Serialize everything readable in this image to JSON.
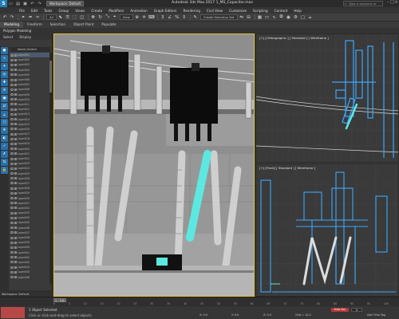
{
  "app": {
    "logo": "S",
    "workspace": "Workspace: Default",
    "title": "Autodesk 3ds Max 2017    1_MS_Capacitor.max",
    "search_placeholder": "Type a keyword or phrase"
  },
  "menu": [
    "File",
    "Edit",
    "Tools",
    "Group",
    "Views",
    "Create",
    "Modifiers",
    "Animation",
    "Graph Editors",
    "Rendering",
    "Civil View",
    "Customize",
    "Scripting",
    "Content",
    "Help"
  ],
  "toolbar": {
    "filter_dropdown": "All",
    "view_dropdown": "View",
    "selection_set": "Create Selection Set"
  },
  "ribbon": {
    "tabs": [
      "Modeling",
      "Freeform",
      "Selection",
      "Object Paint",
      "Populate"
    ],
    "active_tab": "Modeling",
    "sub_label": "Polygon Modeling"
  },
  "explorer": {
    "tabs": [
      "Select",
      "Display"
    ],
    "header": "Name (Sorted Ascending)",
    "rows": [
      "Layer001",
      "Layer002",
      "Layer003",
      "Layer004",
      "Layer005",
      "Layer006",
      "Layer007",
      "Layer008",
      "Layer009",
      "Layer010",
      "Layer011",
      "Layer012",
      "Layer013",
      "Layer014",
      "Layer015",
      "Layer016",
      "Layer017",
      "Layer018",
      "Layer019",
      "Layer020",
      "Layer021",
      "Layer022",
      "Layer023",
      "Layer024",
      "Layer025",
      "Layer026",
      "Layer027",
      "Layer028",
      "Layer029",
      "Layer030",
      "Layer031",
      "Layer032",
      "Layer033",
      "Layer034",
      "Layer035",
      "Layer036",
      "Layer037",
      "Layer038",
      "Layer039",
      "Layer040",
      "Layer041",
      "Layer042",
      "Layer043",
      "Layer044",
      "Layer045",
      "Layer046"
    ],
    "bottom_label": "Workspace: Default"
  },
  "viewports": {
    "left_label": "[+] [Orthographic ] [ Standard ] [ Wireframe ]",
    "front_label": "[+] [Front] [ Standard ] [ Wireframe ]"
  },
  "timeline": {
    "slider": "0 / 100",
    "ticks": [
      "0",
      "5",
      "10",
      "15",
      "20",
      "25",
      "30",
      "35",
      "40",
      "45",
      "50",
      "55",
      "60",
      "65",
      "70",
      "75",
      "80",
      "85",
      "90",
      "95",
      "100"
    ]
  },
  "status": {
    "selected": "1 Object Selected",
    "hint": "Click or click-and-drag to select objects",
    "x": "X: 0.0",
    "y": "Y: 0.0",
    "z": "Z: 0.0",
    "grid": "Grid = 10.0",
    "auto_key": "Auto Key",
    "frame": "0",
    "add_time_tag": "Add Time Tag"
  },
  "colors": {
    "wire_blue": "#3aa8ff",
    "selected_cyan": "#5ce8e0",
    "active_border": "#e3c02a",
    "shaded_bg": "#8d8d8d"
  }
}
